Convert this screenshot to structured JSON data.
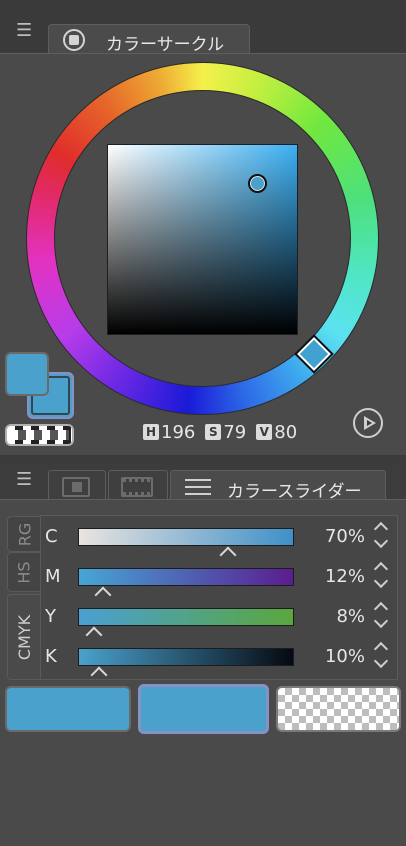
{
  "color_circle_panel": {
    "tab_label": "カラーサークル",
    "hue_label": "H",
    "hue_value": "196",
    "saturation_label": "S",
    "saturation_value": "79",
    "value_label": "V",
    "value_value": "80",
    "current_color": "#4aa1cc"
  },
  "slider_panel": {
    "tab_label": "カラースライダー",
    "side_tabs": [
      "RG",
      "HS",
      "CMYK"
    ],
    "rows": [
      {
        "label": "C",
        "percent": "70%",
        "value": 70,
        "gradient": [
          "#e9e4e0",
          "#3f90c8"
        ]
      },
      {
        "label": "M",
        "percent": "12%",
        "value": 12,
        "gradient": [
          "#46a6d6",
          "#5a1d90"
        ]
      },
      {
        "label": "Y",
        "percent": "8%",
        "value": 8,
        "gradient": [
          "#4aa0d2",
          "#5aa63e"
        ]
      },
      {
        "label": "K",
        "percent": "10%",
        "value": 10,
        "gradient": [
          "#4aa1cc",
          "#050912"
        ]
      }
    ],
    "swatches": [
      "#4aa1cc",
      "#4aa1cc",
      "transparent"
    ]
  }
}
